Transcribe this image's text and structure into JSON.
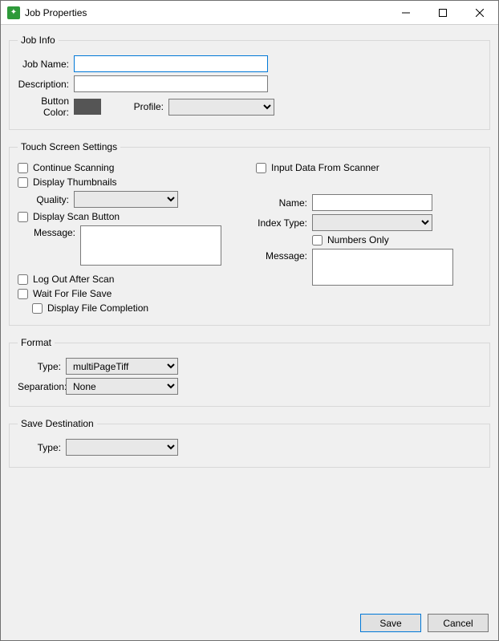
{
  "window": {
    "title": "Job Properties"
  },
  "jobInfo": {
    "legend": "Job Info",
    "jobNameLabel": "Job Name:",
    "jobName": "",
    "descriptionLabel": "Description:",
    "description": "",
    "buttonColorLabel": "Button Color:",
    "buttonColor": "#555555",
    "profileLabel": "Profile:",
    "profile": ""
  },
  "touch": {
    "legend": "Touch Screen Settings",
    "continueScanning": "Continue Scanning",
    "displayThumbnails": "Display Thumbnails",
    "qualityLabel": "Quality:",
    "quality": "",
    "displayScanButton": "Display Scan Button",
    "messageLabel": "Message:",
    "scanButtonMessage": "",
    "logOutAfterScan": "Log Out After Scan",
    "waitForFileSave": "Wait For File Save",
    "displayFileCompletion": "Display File Completion",
    "inputDataFromScanner": "Input Data From Scanner",
    "nameLabel": "Name:",
    "name": "",
    "indexTypeLabel": "Index Type:",
    "indexType": "",
    "numbersOnly": "Numbers Only",
    "messageLabel2": "Message:",
    "scannerMessage": ""
  },
  "format": {
    "legend": "Format",
    "typeLabel": "Type:",
    "type": "multiPageTiff",
    "separationLabel": "Separation:",
    "separation": "None"
  },
  "saveDest": {
    "legend": "Save Destination",
    "typeLabel": "Type:",
    "type": ""
  },
  "buttons": {
    "save": "Save",
    "cancel": "Cancel"
  }
}
